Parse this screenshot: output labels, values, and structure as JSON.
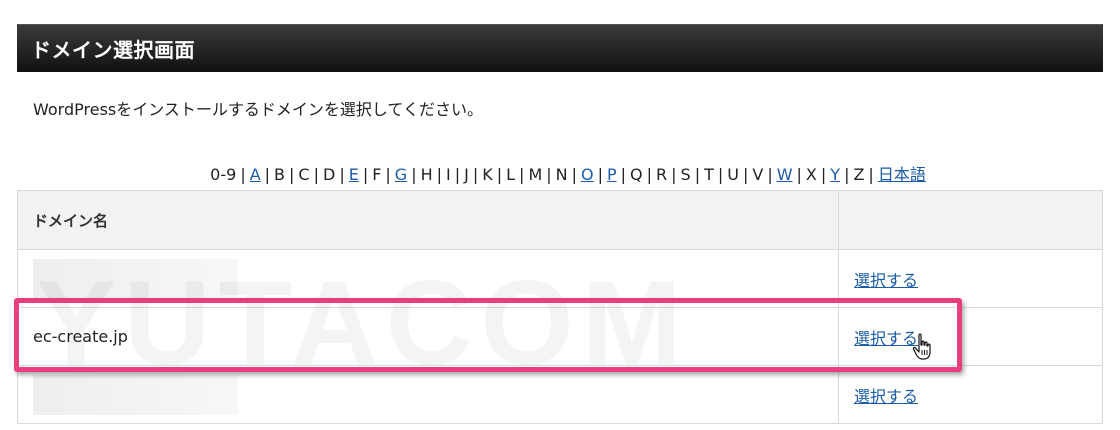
{
  "header": {
    "title": "ドメイン選択画面"
  },
  "intro": {
    "text": "WordPressをインストールするドメインを選択してください。"
  },
  "alpha_nav": {
    "items": [
      {
        "label": "0-9",
        "link": false
      },
      {
        "label": "A",
        "link": true
      },
      {
        "label": "B",
        "link": false
      },
      {
        "label": "C",
        "link": false
      },
      {
        "label": "D",
        "link": false
      },
      {
        "label": "E",
        "link": true
      },
      {
        "label": "F",
        "link": false
      },
      {
        "label": "G",
        "link": true
      },
      {
        "label": "H",
        "link": false
      },
      {
        "label": "I",
        "link": false
      },
      {
        "label": "J",
        "link": false
      },
      {
        "label": "K",
        "link": false
      },
      {
        "label": "L",
        "link": false
      },
      {
        "label": "M",
        "link": false
      },
      {
        "label": "N",
        "link": false
      },
      {
        "label": "O",
        "link": true
      },
      {
        "label": "P",
        "link": true
      },
      {
        "label": "Q",
        "link": false
      },
      {
        "label": "R",
        "link": false
      },
      {
        "label": "S",
        "link": false
      },
      {
        "label": "T",
        "link": false
      },
      {
        "label": "U",
        "link": false
      },
      {
        "label": "V",
        "link": false
      },
      {
        "label": "W",
        "link": true
      },
      {
        "label": "X",
        "link": false
      },
      {
        "label": "Y",
        "link": true
      },
      {
        "label": "Z",
        "link": false
      },
      {
        "label": "日本語",
        "link": true
      }
    ],
    "separator": "|"
  },
  "table": {
    "headers": [
      "ドメイン名",
      ""
    ],
    "rows": [
      {
        "domain": "",
        "action": "選択する"
      },
      {
        "domain": "ec-create.jp",
        "action": "選択する"
      },
      {
        "domain": "",
        "action": "選択する"
      }
    ]
  },
  "watermark": {
    "text": "YUTACOM"
  },
  "colors": {
    "highlight": "#e83e7d",
    "link": "#1a5ca8",
    "title_bar": "#1c1c1c"
  },
  "cursor": {
    "icon": "hand-pointer-icon"
  }
}
